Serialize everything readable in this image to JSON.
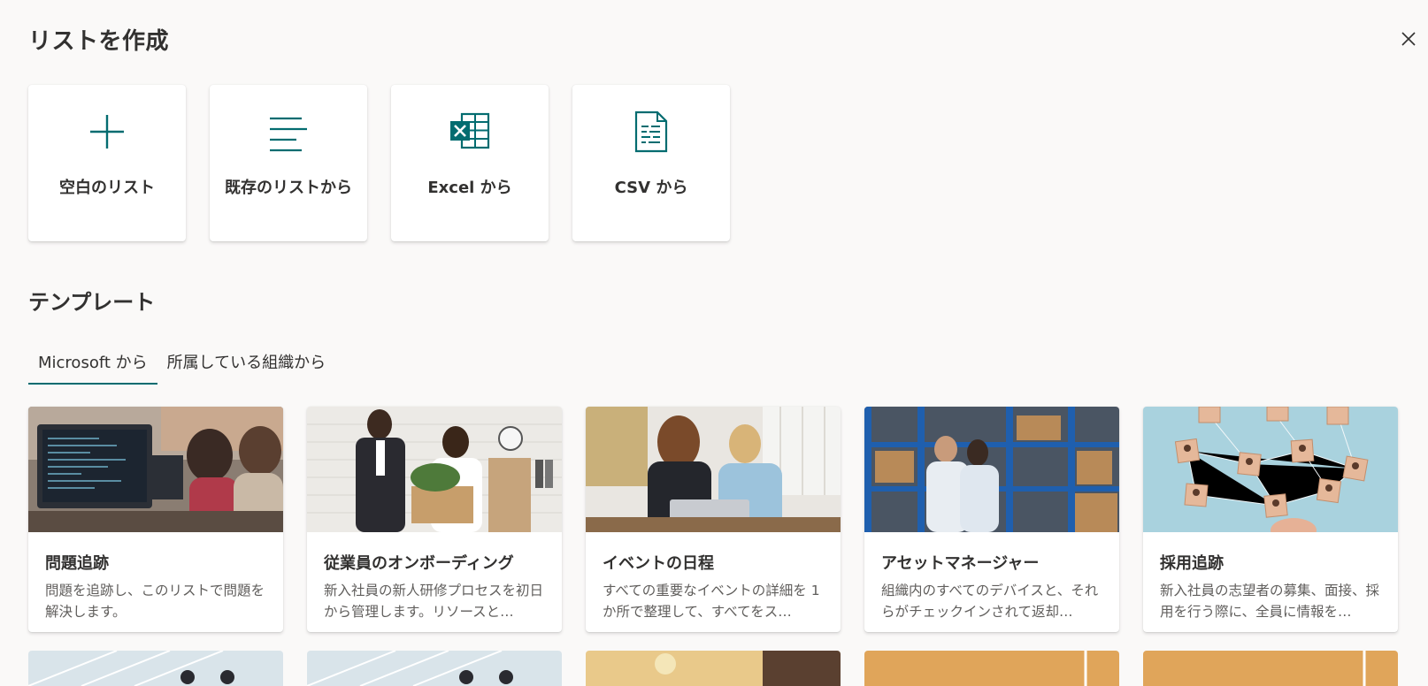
{
  "header": {
    "title": "リストを作成"
  },
  "create_options": [
    {
      "label": "空白のリスト",
      "icon": "plus-icon"
    },
    {
      "label": "既存のリストから",
      "icon": "list-lines-icon"
    },
    {
      "label": "Excel から",
      "icon": "excel-icon"
    },
    {
      "label": "CSV から",
      "icon": "csv-file-icon"
    }
  ],
  "templates_section": {
    "title": "テンプレート"
  },
  "tabs": [
    {
      "label": "Microsoft から",
      "active": true
    },
    {
      "label": "所属している組織から",
      "active": false
    }
  ],
  "templates": [
    {
      "title": "問題追跡",
      "description": "問題を追跡し、このリストで問題を解決します。"
    },
    {
      "title": "従業員のオンボーディング",
      "description": "新入社員の新人研修プロセスを初日から管理します。リソースと…"
    },
    {
      "title": "イベントの日程",
      "description": "すべての重要なイベントの詳細を 1 か所で整理して、すべてをス…"
    },
    {
      "title": "アセットマネージャー",
      "description": "組織内のすべてのデバイスと、それらがチェックインされて返却…"
    },
    {
      "title": "採用追跡",
      "description": "新入社員の志望者の募集、面接、採用を行う際に、全員に情報を…"
    }
  ],
  "colors": {
    "accent": "#036c70",
    "background": "#faf9f8",
    "card": "#ffffff"
  }
}
